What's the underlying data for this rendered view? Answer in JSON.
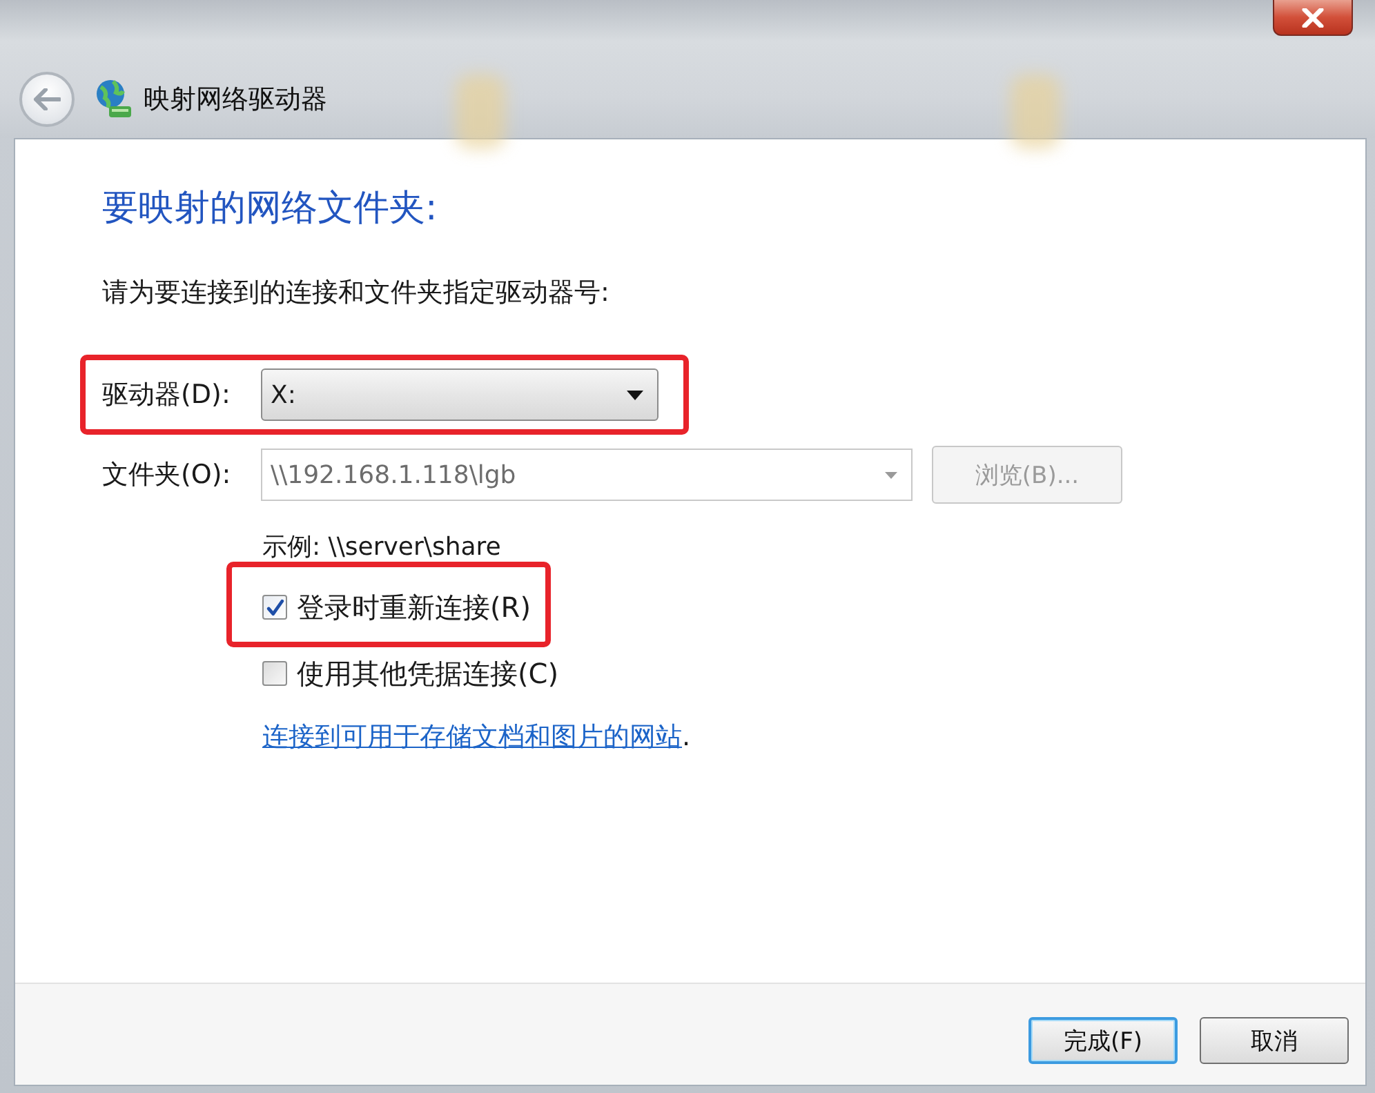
{
  "window": {
    "title": "映射网络驱动器"
  },
  "heading": "要映射的网络文件夹:",
  "instruction": "请为要连接到的连接和文件夹指定驱动器号:",
  "drive": {
    "label": "驱动器(D):",
    "value": "X:",
    "highlighted": true
  },
  "folder": {
    "label": "文件夹(O):",
    "value": "\\\\192.168.1.118\\lgb",
    "browse_button": {
      "label": "浏览(B)...",
      "disabled": true
    }
  },
  "example": "示例: \\\\server\\share",
  "checkboxes": [
    {
      "label": "登录时重新连接(R)",
      "checked": true,
      "highlighted": true
    },
    {
      "label": "使用其他凭据连接(C)",
      "checked": false,
      "highlighted": false
    }
  ],
  "link": {
    "text": "连接到可用于存储文档和图片的网站",
    "suffix": "."
  },
  "buttons": [
    {
      "label": "完成(F)",
      "default": true
    },
    {
      "label": "取消",
      "default": false
    }
  ]
}
